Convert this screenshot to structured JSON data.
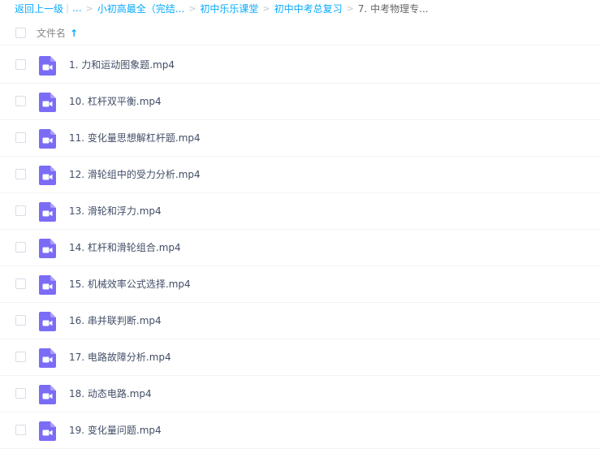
{
  "breadcrumb": {
    "back": "返回上一级",
    "ellipsis": "...",
    "items": [
      "小初高最全（完结...",
      "初中乐乐课堂",
      "初中中考总复习"
    ],
    "current": "7. 中考物理专..."
  },
  "header": {
    "column_name": "文件名",
    "sort_icon": "arrow-up-icon",
    "sort_direction": "ascending"
  },
  "files": [
    {
      "name": "1. 力和运动图象题.mp4",
      "icon": "video-file-icon"
    },
    {
      "name": "10. 杠杆双平衡.mp4",
      "icon": "video-file-icon"
    },
    {
      "name": "11. 变化量思想解杠杆题.mp4",
      "icon": "video-file-icon"
    },
    {
      "name": "12. 滑轮组中的受力分析.mp4",
      "icon": "video-file-icon"
    },
    {
      "name": "13. 滑轮和浮力.mp4",
      "icon": "video-file-icon"
    },
    {
      "name": "14. 杠杆和滑轮组合.mp4",
      "icon": "video-file-icon"
    },
    {
      "name": "15. 机械效率公式选择.mp4",
      "icon": "video-file-icon"
    },
    {
      "name": "16. 串并联判断.mp4",
      "icon": "video-file-icon"
    },
    {
      "name": "17. 电路故障分析.mp4",
      "icon": "video-file-icon"
    },
    {
      "name": "18. 动态电路.mp4",
      "icon": "video-file-icon"
    },
    {
      "name": "19. 变化量问题.mp4",
      "icon": "video-file-icon"
    }
  ],
  "colors": {
    "link": "#09aaff",
    "video_icon": "#7b6cf6",
    "text": "#424e67"
  }
}
